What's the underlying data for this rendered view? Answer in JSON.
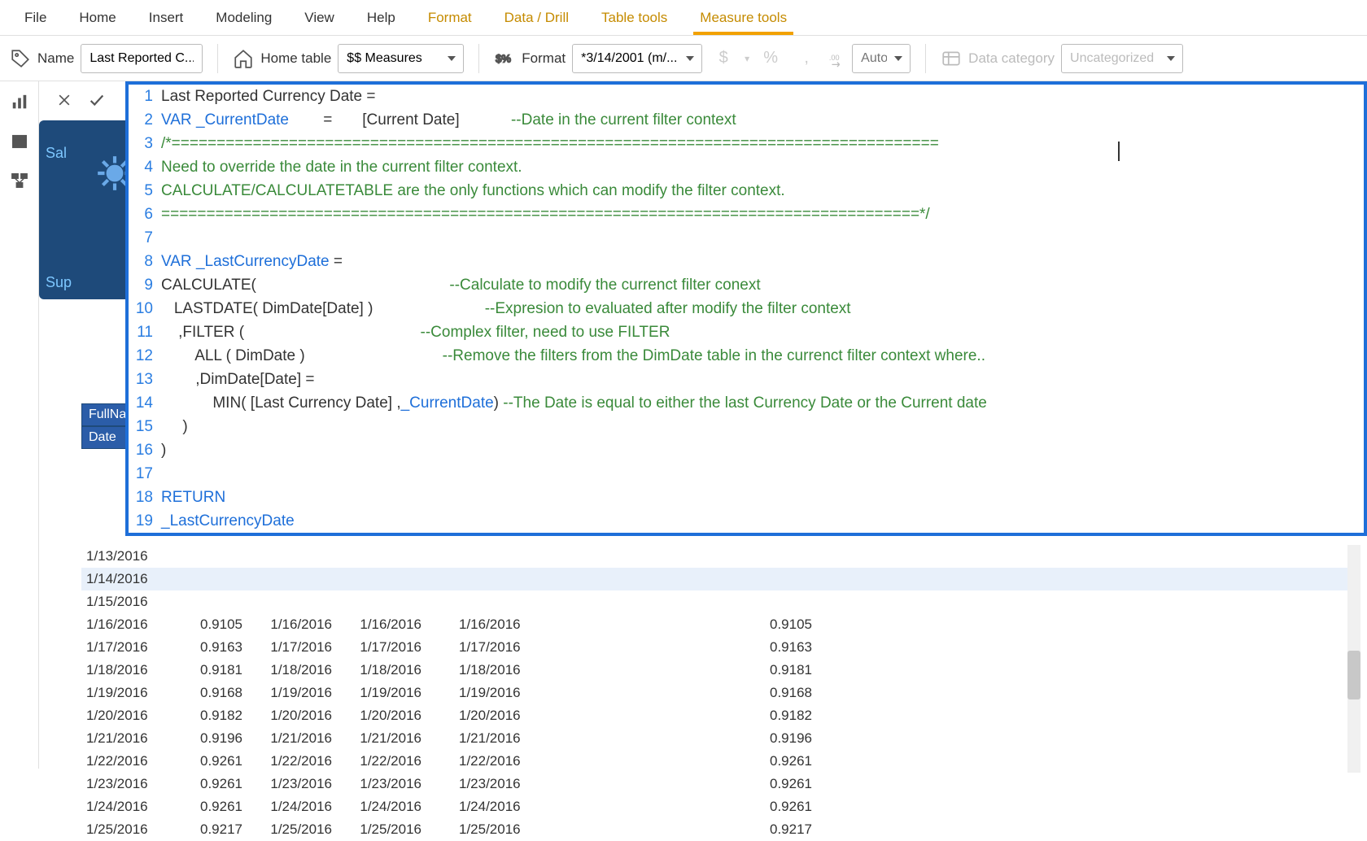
{
  "ribbon": {
    "tabs": [
      "File",
      "Home",
      "Insert",
      "Modeling",
      "View",
      "Help",
      "Format",
      "Data / Drill",
      "Table tools",
      "Measure tools"
    ],
    "active_index": 9,
    "contextual_start_index": 6
  },
  "toolbar": {
    "name_label": "Name",
    "name_value": "Last Reported C...",
    "home_table_label": "Home table",
    "home_table_value": "$$ Measures",
    "format_label": "Format",
    "format_value": "*3/14/2001 (m/...",
    "currency_symbol": "$",
    "percent_symbol": "%",
    "comma_symbol": ",",
    "decimals_placeholder": "Auto",
    "data_category_label": "Data category",
    "data_category_value": "Uncategorized"
  },
  "formula": {
    "lines": [
      {
        "n": "1",
        "segs": [
          [
            "plain",
            "Last Reported Currency Date ="
          ]
        ]
      },
      {
        "n": "2",
        "segs": [
          [
            "kw",
            "VAR "
          ],
          [
            "var",
            "_CurrentDate"
          ],
          [
            "plain",
            "        =       "
          ],
          [
            "bracket",
            "[Current Date]"
          ],
          [
            "plain",
            "            "
          ],
          [
            "comment",
            "--Date in the current filter context"
          ]
        ]
      },
      {
        "n": "3",
        "segs": [
          [
            "comment",
            "/*====================================================================================="
          ]
        ]
      },
      {
        "n": "4",
        "segs": [
          [
            "comment",
            "Need to override the date in the current filter context."
          ]
        ]
      },
      {
        "n": "5",
        "segs": [
          [
            "comment",
            "CALCULATE/CALCULATETABLE are the only functions which can modify the filter context."
          ]
        ]
      },
      {
        "n": "6",
        "segs": [
          [
            "comment",
            "====================================================================================*/"
          ]
        ]
      },
      {
        "n": "7",
        "segs": [
          [
            "plain",
            " "
          ]
        ]
      },
      {
        "n": "8",
        "segs": [
          [
            "kw",
            "VAR "
          ],
          [
            "var",
            "_LastCurrencyDate"
          ],
          [
            "plain",
            " ="
          ]
        ]
      },
      {
        "n": "9",
        "segs": [
          [
            "func",
            "CALCULATE"
          ],
          [
            "plain",
            "("
          ],
          [
            "plain",
            "                                             "
          ],
          [
            "comment",
            "--Calculate to modify the currenct filter conext"
          ]
        ]
      },
      {
        "n": "10",
        "segs": [
          [
            "plain",
            "   "
          ],
          [
            "func",
            "LASTDATE"
          ],
          [
            "plain",
            "( DimDate[Date] )"
          ],
          [
            "plain",
            "                          "
          ],
          [
            "comment",
            "--Expresion to evaluated after modify the filter context"
          ]
        ]
      },
      {
        "n": "11",
        "segs": [
          [
            "plain",
            "    ,"
          ],
          [
            "func",
            "FILTER"
          ],
          [
            "plain",
            " ("
          ],
          [
            "plain",
            "                                         "
          ],
          [
            "comment",
            "--Complex filter, need to use FILTER"
          ]
        ]
      },
      {
        "n": "12",
        "segs": [
          [
            "plain",
            "        "
          ],
          [
            "func",
            "ALL"
          ],
          [
            "plain",
            " ( DimDate )"
          ],
          [
            "plain",
            "                                "
          ],
          [
            "comment",
            "--Remove the filters from the DimDate table in the currenct filter context where.."
          ]
        ]
      },
      {
        "n": "13",
        "segs": [
          [
            "plain",
            "        ,DimDate[Date] ="
          ]
        ]
      },
      {
        "n": "14",
        "segs": [
          [
            "plain",
            "            "
          ],
          [
            "func",
            "MIN"
          ],
          [
            "plain",
            "( "
          ],
          [
            "bracket",
            "[Last Currency Date]"
          ],
          [
            "plain",
            " ,"
          ],
          [
            "var",
            "_CurrentDate"
          ],
          [
            "plain",
            ") "
          ],
          [
            "comment",
            "--The Date is equal to either the last Currency Date or the Current date"
          ]
        ]
      },
      {
        "n": "15",
        "segs": [
          [
            "plain",
            "     )"
          ]
        ]
      },
      {
        "n": "16",
        "segs": [
          [
            "plain",
            ")"
          ]
        ]
      },
      {
        "n": "17",
        "segs": [
          [
            "plain",
            " "
          ]
        ]
      },
      {
        "n": "18",
        "segs": [
          [
            "kw",
            "RETURN"
          ]
        ]
      },
      {
        "n": "19",
        "segs": [
          [
            "var",
            "_LastCurrencyDate"
          ]
        ]
      }
    ]
  },
  "viz_header": {
    "col1": "FullName",
    "col2": "Date"
  },
  "hidden_panel": {
    "top_text": "Sal",
    "bottom_text": "Sup"
  },
  "grid": {
    "rows": [
      {
        "date": "1/13/2016",
        "v": "",
        "d1": "",
        "d2": "",
        "d3": "",
        "v2": ""
      },
      {
        "date": "1/14/2016",
        "v": "",
        "d1": "",
        "d2": "",
        "d3": "",
        "v2": "",
        "sel": true
      },
      {
        "date": "1/15/2016",
        "v": "",
        "d1": "",
        "d2": "",
        "d3": "",
        "v2": ""
      },
      {
        "date": "1/16/2016",
        "v": "0.9105",
        "d1": "1/16/2016",
        "d2": "1/16/2016",
        "d3": "1/16/2016",
        "v2": "0.9105",
        "partial": true
      },
      {
        "date": "1/17/2016",
        "v": "0.9163",
        "d1": "1/17/2016",
        "d2": "1/17/2016",
        "d3": "1/17/2016",
        "v2": "0.9163"
      },
      {
        "date": "1/18/2016",
        "v": "0.9181",
        "d1": "1/18/2016",
        "d2": "1/18/2016",
        "d3": "1/18/2016",
        "v2": "0.9181"
      },
      {
        "date": "1/19/2016",
        "v": "0.9168",
        "d1": "1/19/2016",
        "d2": "1/19/2016",
        "d3": "1/19/2016",
        "v2": "0.9168"
      },
      {
        "date": "1/20/2016",
        "v": "0.9182",
        "d1": "1/20/2016",
        "d2": "1/20/2016",
        "d3": "1/20/2016",
        "v2": "0.9182"
      },
      {
        "date": "1/21/2016",
        "v": "0.9196",
        "d1": "1/21/2016",
        "d2": "1/21/2016",
        "d3": "1/21/2016",
        "v2": "0.9196"
      },
      {
        "date": "1/22/2016",
        "v": "0.9261",
        "d1": "1/22/2016",
        "d2": "1/22/2016",
        "d3": "1/22/2016",
        "v2": "0.9261"
      },
      {
        "date": "1/23/2016",
        "v": "0.9261",
        "d1": "1/23/2016",
        "d2": "1/23/2016",
        "d3": "1/23/2016",
        "v2": "0.9261"
      },
      {
        "date": "1/24/2016",
        "v": "0.9261",
        "d1": "1/24/2016",
        "d2": "1/24/2016",
        "d3": "1/24/2016",
        "v2": "0.9261"
      },
      {
        "date": "1/25/2016",
        "v": "0.9217",
        "d1": "1/25/2016",
        "d2": "1/25/2016",
        "d3": "1/25/2016",
        "v2": "0.9217"
      }
    ]
  }
}
